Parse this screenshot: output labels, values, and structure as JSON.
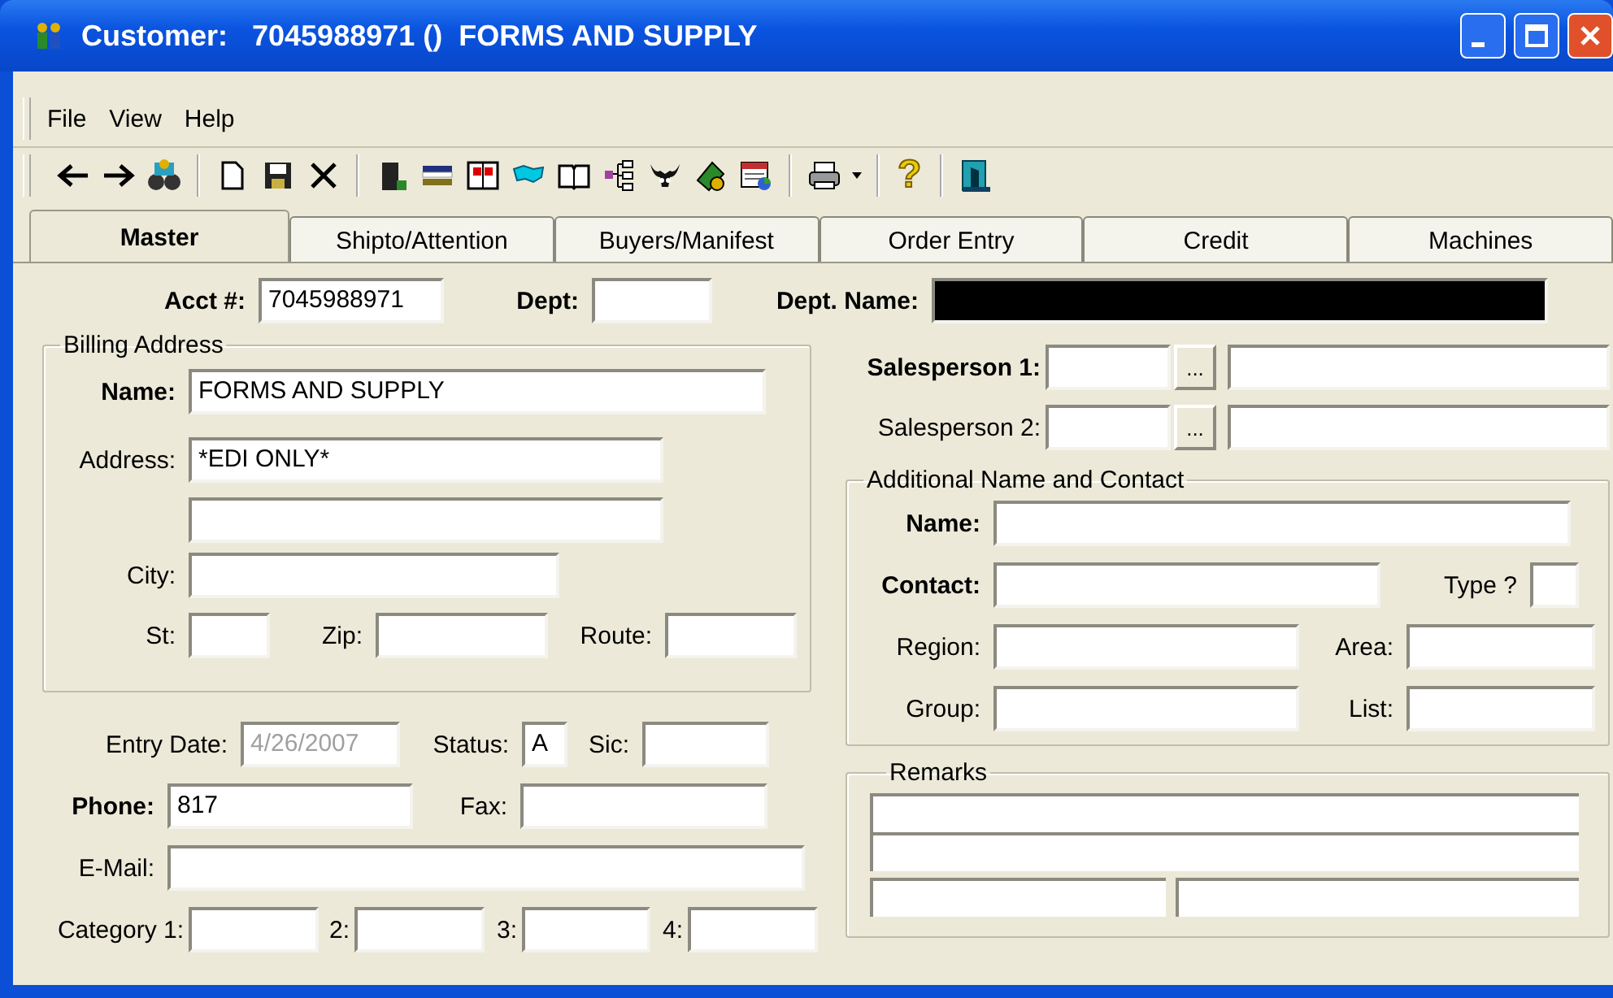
{
  "window": {
    "title": "Customer:   7045988971 ()  FORMS AND SUPPLY"
  },
  "menu": [
    "File",
    "View",
    "Help"
  ],
  "toolbar": {
    "help_glyph": "?"
  },
  "tabs": [
    {
      "label": "Master",
      "selected": true
    },
    {
      "label": "Shipto/Attention",
      "selected": false
    },
    {
      "label": "Buyers/Manifest",
      "selected": false
    },
    {
      "label": "Order Entry",
      "selected": false
    },
    {
      "label": "Credit",
      "selected": false
    },
    {
      "label": "Machines",
      "selected": false
    }
  ],
  "header": [
    {
      "label": "Acct #:",
      "value": "7045988971",
      "bold": true
    },
    {
      "label": "Dept:",
      "bold": true
    },
    {
      "label": "Dept. Name:",
      "bold": true,
      "masked": true
    }
  ],
  "billing_address": {
    "title": "Billing Address",
    "fields": [
      {
        "label": "Name:",
        "value": "FORMS AND SUPPLY",
        "bold": true
      },
      {
        "label": "Address:",
        "value": "*EDI ONLY*",
        "bold": false
      },
      {
        "label": "City:",
        "bold": false
      },
      {
        "label": "St:",
        "bold": false
      },
      {
        "label": "Zip:",
        "bold": false
      },
      {
        "label": "Route:",
        "bold": false
      }
    ]
  },
  "details": [
    {
      "label": "Entry Date:",
      "value": "4/26/2007",
      "bold": false,
      "disabled": true
    },
    {
      "label": "Status:",
      "value": "A",
      "bold": false
    },
    {
      "label": "Sic:",
      "bold": false
    },
    {
      "label": "Phone:",
      "value": "817",
      "bold": true
    },
    {
      "label": "Fax:",
      "bold": false
    },
    {
      "label": "E-Mail:",
      "bold": false
    },
    {
      "label": "Category 1:",
      "bold": false
    },
    {
      "label": "2:",
      "bold": false
    },
    {
      "label": "3:",
      "bold": false
    },
    {
      "label": "4:",
      "bold": false
    }
  ],
  "salespersons": [
    {
      "label": "Salesperson 1:",
      "bold": true,
      "button": "..."
    },
    {
      "label": "Salesperson 2:",
      "bold": false,
      "button": "..."
    }
  ],
  "additional_contact": {
    "title": "Additional Name and Contact",
    "fields": [
      {
        "label": "Name:",
        "bold": true
      },
      {
        "label": "Contact:",
        "bold": true
      },
      {
        "label": "Type ?",
        "bold": false
      },
      {
        "label": "Region:",
        "bold": false
      },
      {
        "label": "Area:",
        "bold": false
      },
      {
        "label": "Group:",
        "bold": false
      },
      {
        "label": "List:",
        "bold": false
      }
    ]
  },
  "remarks": {
    "title": "Remarks"
  }
}
